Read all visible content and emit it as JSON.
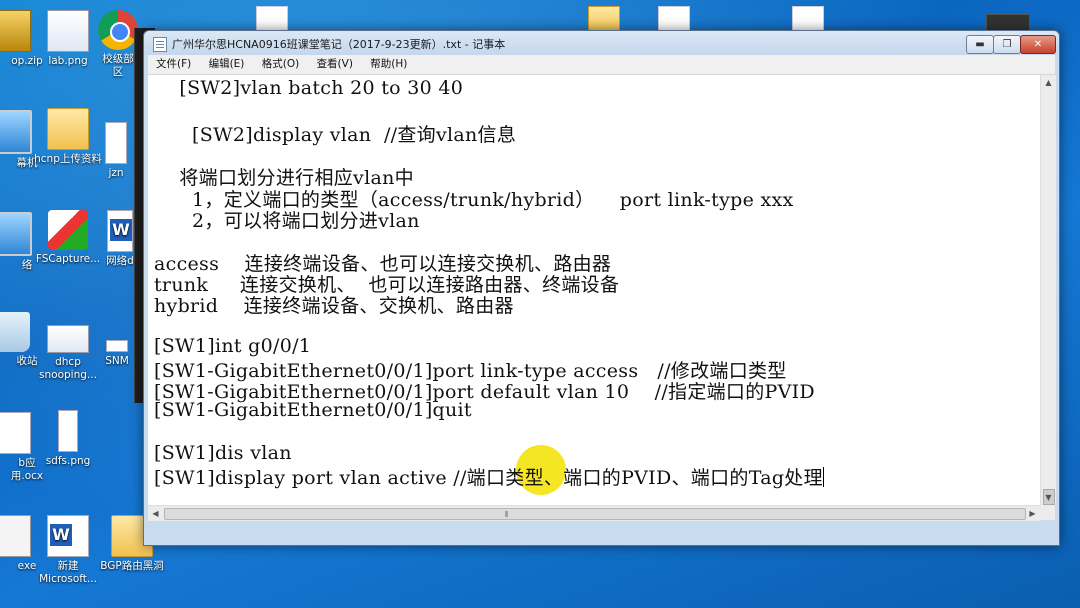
{
  "window": {
    "title": "广州华尔思HCNA0916班课堂笔记（2017-9-23更新）.txt - 记事本",
    "min_label": "▬",
    "max_label": "❐",
    "close_label": "✕"
  },
  "menu": [
    {
      "label": "文件(F)"
    },
    {
      "label": "编辑(E)"
    },
    {
      "label": "格式(O)"
    },
    {
      "label": "查看(V)"
    },
    {
      "label": "帮助(H)"
    }
  ],
  "lines": [
    "    [SW2]vlan batch 20 to 30 40",
    "",
    "      [SW2]display vlan  //查询vlan信息",
    "",
    "    将端口划分进行相应vlan中",
    "      1，定义端口的类型（access/trunk/hybrid）    port link-type xxx",
    "      2，可以将端口划分进vlan",
    "",
    "access    连接终端设备、也可以连接交换机、路由器",
    "trunk     连接交换机、  也可以连接路由器、终端设备",
    "hybrid    连接终端设备、交换机、路由器",
    "",
    "[SW1]int g0/0/1",
    "[SW1-GigabitEthernet0/0/1]port link-type access   //修改端口类型",
    "[SW1-GigabitEthernet0/0/1]port default vlan 10    //指定端口的PVID",
    "[SW1-GigabitEthernet0/0/1]quit",
    "",
    "[SW1]dis vlan",
    "[SW1]display port vlan active //端口类型、端口的PVID、端口的Tag处理"
  ],
  "desktop_icons": [
    {
      "label": "op.zip",
      "icon": "zip-icon"
    },
    {
      "label": "lab.png",
      "icon": "image-icon"
    },
    {
      "label": "校级部区",
      "icon": "chrome-icon"
    },
    {
      "label": "幕机",
      "icon": "computer-icon"
    },
    {
      "label": "hcnp上传资料",
      "icon": "folder-icon"
    },
    {
      "label": "jzn",
      "icon": "document-icon"
    },
    {
      "label": "络",
      "icon": "network-icon"
    },
    {
      "label": "FSCapture...",
      "icon": "fscapture-icon"
    },
    {
      "label": "网络d",
      "icon": "word-icon"
    },
    {
      "label": "收站",
      "icon": "recycle-bin-icon"
    },
    {
      "label": "dhcp snooping...",
      "icon": "image-icon"
    },
    {
      "label": "SNM",
      "icon": "document-icon"
    },
    {
      "label": "b应用.ocx",
      "icon": "document-icon"
    },
    {
      "label": "sdfs.png",
      "icon": "image-icon"
    },
    {
      "label": "exe",
      "icon": "exe-icon"
    },
    {
      "label": "新建 Microsoft...",
      "icon": "word-icon"
    },
    {
      "label": "BGP路由黑洞",
      "icon": "folder-icon"
    }
  ]
}
